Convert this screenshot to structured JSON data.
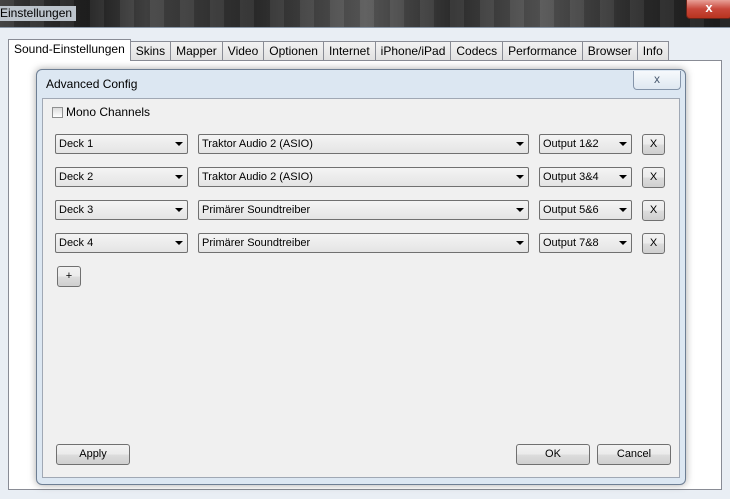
{
  "window": {
    "title": "Einstellungen",
    "close_label": "x"
  },
  "tabs": [
    {
      "label": "Sound-Einstellungen",
      "active": true
    },
    {
      "label": "Skins"
    },
    {
      "label": "Mapper"
    },
    {
      "label": "Video"
    },
    {
      "label": "Optionen"
    },
    {
      "label": "Internet"
    },
    {
      "label": "iPhone/iPad"
    },
    {
      "label": "Codecs"
    },
    {
      "label": "Performance"
    },
    {
      "label": "Browser"
    },
    {
      "label": "Info"
    }
  ],
  "dialog": {
    "title": "Advanced Config",
    "mono_channels": {
      "label": "Mono Channels",
      "checked": false
    },
    "rows": [
      {
        "deck": "Deck 1",
        "driver": "Traktor Audio 2 (ASIO)",
        "output": "Output 1&2",
        "remove": "X"
      },
      {
        "deck": "Deck 2",
        "driver": "Traktor Audio 2 (ASIO)",
        "output": "Output 3&4",
        "remove": "X"
      },
      {
        "deck": "Deck 3",
        "driver": "Primärer Soundtreiber",
        "output": "Output 5&6",
        "remove": "X"
      },
      {
        "deck": "Deck 4",
        "driver": "Primärer Soundtreiber",
        "output": "Output 7&8",
        "remove": "X"
      }
    ],
    "add_label": "+",
    "apply_label": "Apply",
    "ok_label": "OK",
    "cancel_label": "Cancel"
  }
}
